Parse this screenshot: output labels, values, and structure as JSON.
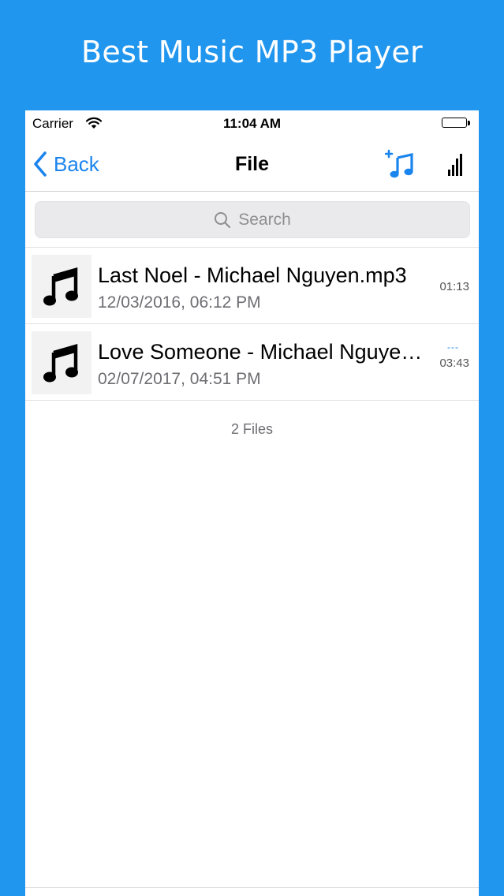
{
  "promo": {
    "title": "Best Music MP3 Player"
  },
  "status_bar": {
    "carrier": "Carrier",
    "time": "11:04 AM"
  },
  "navbar": {
    "back_label": "Back",
    "title": "File",
    "icons": [
      "back-chevron-icon",
      "add-music-icon",
      "signal-bars-icon"
    ],
    "accent_color": "#1a84ee"
  },
  "search": {
    "placeholder": "Search"
  },
  "files": [
    {
      "name": "Last Noel - Michael Nguyen.mp3",
      "date": "12/03/2016, 06:12 PM",
      "duration": "01:13",
      "playing": false
    },
    {
      "name": "Love Someone - Michael Nguyen.mp3",
      "date": "02/07/2017, 04:51 PM",
      "duration": "03:43",
      "playing": true,
      "playing_indicator": "---"
    }
  ],
  "footer": {
    "files_count": "2 Files"
  },
  "colors": {
    "background": "#2196ee",
    "accent": "#1a84ee"
  }
}
